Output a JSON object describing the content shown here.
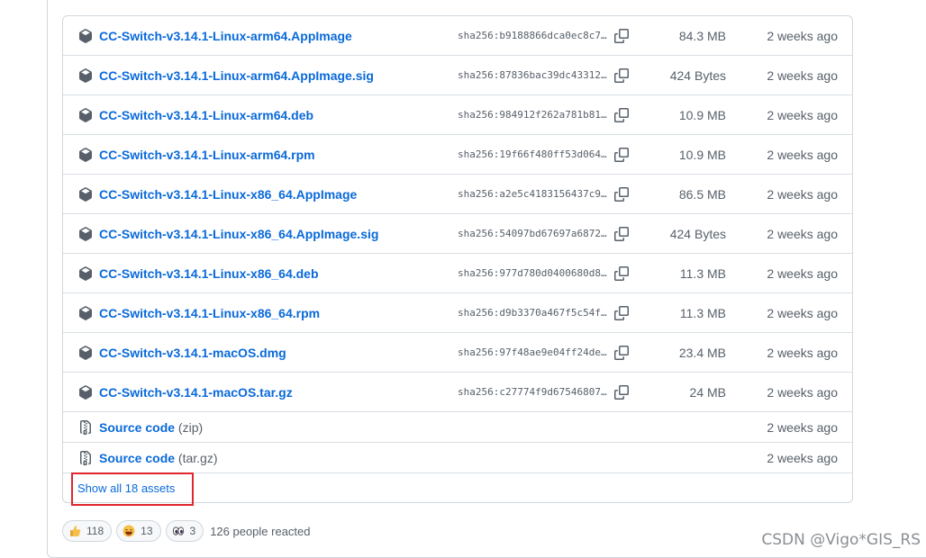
{
  "assets": [
    {
      "name": "CC-Switch-v3.14.1-Linux-arm64.AppImage",
      "sha": "sha256:b9188866dca0ec8c7…",
      "size": "84.3 MB",
      "date": "2 weeks ago"
    },
    {
      "name": "CC-Switch-v3.14.1-Linux-arm64.AppImage.sig",
      "sha": "sha256:87836bac39dc43312…",
      "size": "424 Bytes",
      "date": "2 weeks ago"
    },
    {
      "name": "CC-Switch-v3.14.1-Linux-arm64.deb",
      "sha": "sha256:984912f262a781b81…",
      "size": "10.9 MB",
      "date": "2 weeks ago"
    },
    {
      "name": "CC-Switch-v3.14.1-Linux-arm64.rpm",
      "sha": "sha256:19f66f480ff53d064…",
      "size": "10.9 MB",
      "date": "2 weeks ago"
    },
    {
      "name": "CC-Switch-v3.14.1-Linux-x86_64.AppImage",
      "sha": "sha256:a2e5c4183156437c9…",
      "size": "86.5 MB",
      "date": "2 weeks ago"
    },
    {
      "name": "CC-Switch-v3.14.1-Linux-x86_64.AppImage.sig",
      "sha": "sha256:54097bd67697a6872…",
      "size": "424 Bytes",
      "date": "2 weeks ago"
    },
    {
      "name": "CC-Switch-v3.14.1-Linux-x86_64.deb",
      "sha": "sha256:977d780d0400680d8…",
      "size": "11.3 MB",
      "date": "2 weeks ago"
    },
    {
      "name": "CC-Switch-v3.14.1-Linux-x86_64.rpm",
      "sha": "sha256:d9b3370a467f5c54f…",
      "size": "11.3 MB",
      "date": "2 weeks ago"
    },
    {
      "name": "CC-Switch-v3.14.1-macOS.dmg",
      "sha": "sha256:97f48ae9e04ff24de…",
      "size": "23.4 MB",
      "date": "2 weeks ago"
    },
    {
      "name": "CC-Switch-v3.14.1-macOS.tar.gz",
      "sha": "sha256:c27774f9d67546807…",
      "size": "24 MB",
      "date": "2 weeks ago"
    }
  ],
  "source": [
    {
      "label": "Source code",
      "suffix": "(zip)",
      "date": "2 weeks ago"
    },
    {
      "label": "Source code",
      "suffix": "(tar.gz)",
      "date": "2 weeks ago"
    }
  ],
  "show_all": "Show all 18 assets",
  "reactions": [
    {
      "emoji": "thumbs-up",
      "count": "118"
    },
    {
      "emoji": "laugh",
      "count": "13"
    },
    {
      "emoji": "eyes",
      "count": "3"
    }
  ],
  "reacted_text": "126 people reacted",
  "watermark": "CSDN @Vigo*GIS_RS",
  "colors": {
    "link": "#0969da",
    "muted": "#57606a",
    "border": "#d0d7de",
    "highlight": "#e0262d"
  }
}
